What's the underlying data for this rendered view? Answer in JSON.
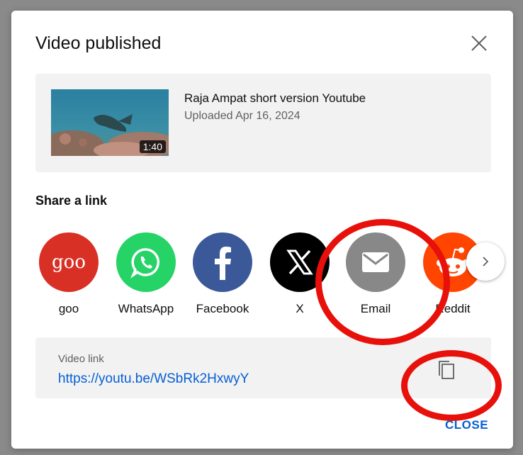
{
  "dialog": {
    "title": "Video published"
  },
  "video": {
    "title": "Raja Ampat short version Youtube",
    "uploaded": "Uploaded Apr 16, 2024",
    "duration": "1:40"
  },
  "share": {
    "heading": "Share a link",
    "items": [
      {
        "label": "goo",
        "icon_text": "goo",
        "color": "#d93025"
      },
      {
        "label": "WhatsApp",
        "color": "#25d366"
      },
      {
        "label": "Facebook",
        "color": "#3b5998"
      },
      {
        "label": "X",
        "color": "#000000"
      },
      {
        "label": "Email",
        "color": "#888888"
      },
      {
        "label": "Reddit",
        "color": "#ff4500"
      }
    ]
  },
  "link": {
    "label": "Video link",
    "url": "https://youtu.be/WSbRk2HxwyY"
  },
  "footer": {
    "close_label": "CLOSE"
  },
  "annotation_color": "#e8100a"
}
